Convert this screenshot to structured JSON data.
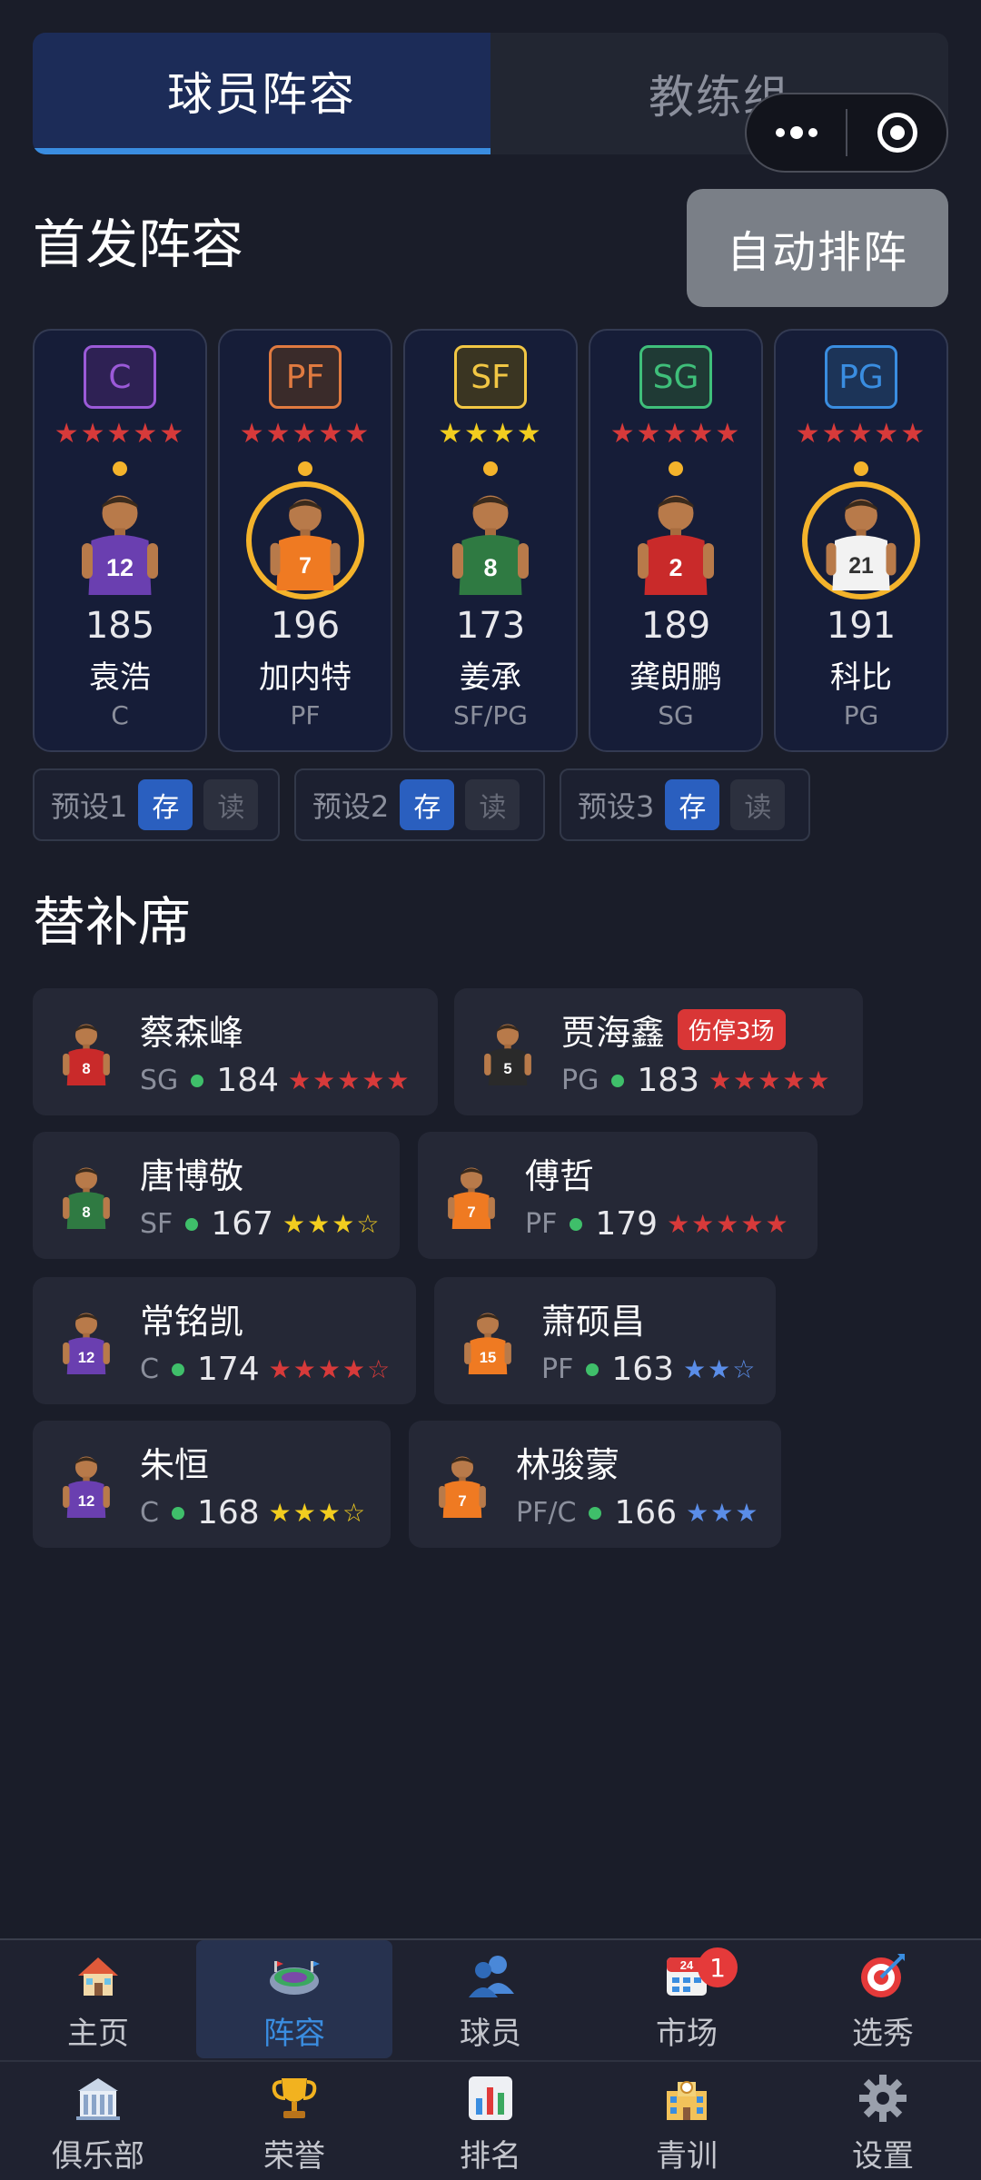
{
  "top_tabs": [
    {
      "label": "球员阵容",
      "active": true
    },
    {
      "label": "教练组",
      "active": false
    }
  ],
  "starting": {
    "title": "首发阵容",
    "auto_button": "自动排阵",
    "players": [
      {
        "slot": "C",
        "slot_color": "#9b5ad8",
        "slot_bg": "#2e2154",
        "stars": "★★★★★",
        "star_color": "#d73a3a",
        "ovr": "185",
        "name": "袁浩",
        "pos": "C",
        "highlight": false,
        "jersey": "12",
        "jersey_color": "#6a3fb0"
      },
      {
        "slot": "PF",
        "slot_color": "#e07a40",
        "slot_bg": "#3a2b2a",
        "stars": "★★★★★",
        "star_color": "#d73a3a",
        "ovr": "196",
        "name": "加内特",
        "pos": "PF",
        "highlight": true,
        "jersey": "7",
        "jersey_color": "#ef7a22"
      },
      {
        "slot": "SF",
        "slot_color": "#f2c744",
        "slot_bg": "#3a3522",
        "stars": "★★★★",
        "star_color": "#f2cd1f",
        "ovr": "173",
        "name": "姜承",
        "pos": "SF/PG",
        "highlight": false,
        "jersey": "8",
        "jersey_color": "#2f7a42"
      },
      {
        "slot": "SG",
        "slot_color": "#3fbf7a",
        "slot_bg": "#1f3a35",
        "stars": "★★★★★",
        "star_color": "#d73a3a",
        "ovr": "189",
        "name": "龚朗鹏",
        "pos": "SG",
        "highlight": false,
        "jersey": "2",
        "jersey_color": "#c92a2a"
      },
      {
        "slot": "PG",
        "slot_color": "#3a8de0",
        "slot_bg": "#1c3458",
        "stars": "★★★★★",
        "star_color": "#d73a3a",
        "ovr": "191",
        "name": "科比",
        "pos": "PG",
        "highlight": true,
        "jersey": "21",
        "jersey_color": "#f2f2f2"
      }
    ]
  },
  "presets": [
    {
      "label": "预设1",
      "save": "存",
      "read": "读"
    },
    {
      "label": "预设2",
      "save": "存",
      "read": "读"
    },
    {
      "label": "预设3",
      "save": "存",
      "read": "读"
    }
  ],
  "bench": {
    "title": "替补席",
    "players": [
      {
        "name": "蔡森峰",
        "pos": "SG",
        "ovr": "184",
        "stars": "★★★★★",
        "star_color": "#d73a3a",
        "injury": "",
        "jersey": "8",
        "jersey_color": "#c92a2a"
      },
      {
        "name": "贾海鑫",
        "pos": "PG",
        "ovr": "183",
        "stars": "★★★★★",
        "star_color": "#d73a3a",
        "injury": "伤停3场",
        "jersey": "5",
        "jersey_color": "#2a2a2a"
      },
      {
        "name": "唐博敬",
        "pos": "SF",
        "ovr": "167",
        "stars": "★★★☆",
        "star_color": "#f2cd1f",
        "injury": "",
        "jersey": "8",
        "jersey_color": "#2f7a42"
      },
      {
        "name": "傅哲",
        "pos": "PF",
        "ovr": "179",
        "stars": "★★★★★",
        "star_color": "#d73a3a",
        "injury": "",
        "jersey": "7",
        "jersey_color": "#ef7a22"
      },
      {
        "name": "常铭凯",
        "pos": "C",
        "ovr": "174",
        "stars": "★★★★☆",
        "star_color": "#d73a3a",
        "injury": "",
        "jersey": "12",
        "jersey_color": "#6a3fb0"
      },
      {
        "name": "萧硕昌",
        "pos": "PF",
        "ovr": "163",
        "stars": "★★☆",
        "star_color": "#5a8de8",
        "injury": "",
        "jersey": "15",
        "jersey_color": "#ef7a22"
      },
      {
        "name": "朱恒",
        "pos": "C",
        "ovr": "168",
        "stars": "★★★☆",
        "star_color": "#f2cd1f",
        "injury": "",
        "jersey": "12",
        "jersey_color": "#6a3fb0"
      },
      {
        "name": "林骏蒙",
        "pos": "PF/C",
        "ovr": "166",
        "stars": "★★★",
        "star_color": "#5a8de8",
        "injury": "",
        "jersey": "7",
        "jersey_color": "#ef7a22"
      }
    ]
  },
  "nav": {
    "row1": [
      {
        "label": "主页",
        "icon": "house-icon",
        "active": false
      },
      {
        "label": "阵容",
        "icon": "stadium-icon",
        "active": true
      },
      {
        "label": "球员",
        "icon": "people-icon",
        "active": false
      },
      {
        "label": "市场",
        "icon": "calendar-icon",
        "active": false,
        "badge": "1",
        "icon_text": "24"
      },
      {
        "label": "选秀",
        "icon": "target-icon",
        "active": false
      }
    ],
    "row2": [
      {
        "label": "俱乐部",
        "icon": "building-icon",
        "active": false
      },
      {
        "label": "荣誉",
        "icon": "trophy-icon",
        "active": false
      },
      {
        "label": "排名",
        "icon": "bar-chart-icon",
        "active": false
      },
      {
        "label": "青训",
        "icon": "school-icon",
        "active": false
      },
      {
        "label": "设置",
        "icon": "gear-icon",
        "active": false
      }
    ]
  }
}
